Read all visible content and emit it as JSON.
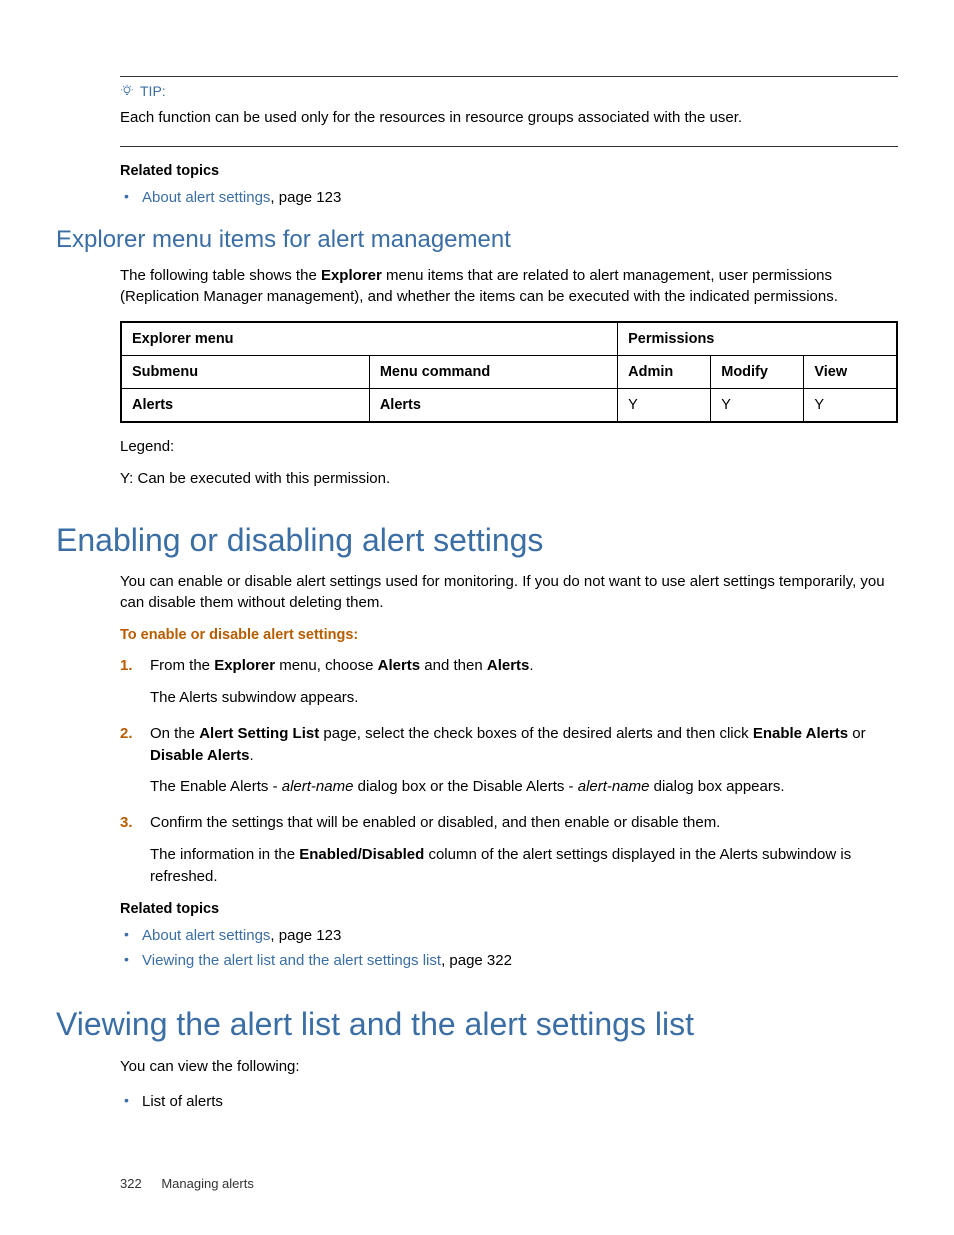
{
  "tip": {
    "label": "TIP:",
    "text": "Each function can be used only for the resources in resource groups associated with the user."
  },
  "related1": {
    "heading": "Related topics",
    "items": [
      {
        "link": "About alert settings",
        "rest": ", page 123"
      }
    ]
  },
  "sec1": {
    "title": "Explorer menu items for alert management",
    "intro_pre": "The following table shows the ",
    "intro_bold": "Explorer",
    "intro_post": " menu items that are related to alert management, user permissions (Replication Manager management), and whether the items can be executed with the indicated permissions."
  },
  "table": {
    "h_explorer": "Explorer menu",
    "h_perms": "Permissions",
    "h_sub": "Submenu",
    "h_cmd": "Menu command",
    "h_admin": "Admin",
    "h_modify": "Modify",
    "h_view": "View",
    "r1_sub": "Alerts",
    "r1_cmd": "Alerts",
    "r1_admin": "Y",
    "r1_modify": "Y",
    "r1_view": "Y"
  },
  "legend": {
    "t1": "Legend:",
    "t2": "Y: Can be executed with this permission."
  },
  "sec2": {
    "title": "Enabling or disabling alert settings",
    "intro": "You can enable or disable alert settings used for monitoring. If you do not want to use alert settings temporarily, you can disable them without deleting them.",
    "steps_heading": "To enable or disable alert settings:",
    "steps": [
      {
        "num": "1.",
        "parts": [
          "From the ",
          "Explorer",
          " menu, choose ",
          "Alerts",
          " and then ",
          "Alerts",
          "."
        ],
        "sub": "The Alerts subwindow appears."
      },
      {
        "num": "2.",
        "parts": [
          "On the ",
          "Alert Setting List",
          " page, select the check boxes of the desired alerts and then click ",
          "Enable Alerts",
          " or ",
          "Disable Alerts",
          "."
        ],
        "sub_parts": [
          "The Enable Alerts - ",
          "alert-name",
          " dialog box or the Disable Alerts - ",
          "alert-name",
          " dialog box appears."
        ]
      },
      {
        "num": "3.",
        "text": "Confirm the settings that will be enabled or disabled, and then enable or disable them.",
        "sub3_parts": [
          "The information in the ",
          "Enabled/Disabled",
          " column of the alert settings displayed in the Alerts subwindow is refreshed."
        ]
      }
    ]
  },
  "related2": {
    "heading": "Related topics",
    "items": [
      {
        "link": "About alert settings",
        "rest": ", page 123"
      },
      {
        "link": "Viewing the alert list and the alert settings list",
        "rest": ", page 322"
      }
    ]
  },
  "sec3": {
    "title": "Viewing the alert list and the alert settings list",
    "intro": "You can view the following:",
    "items": [
      "List of alerts"
    ]
  },
  "footer": {
    "page": "322",
    "chapter": "Managing alerts"
  }
}
